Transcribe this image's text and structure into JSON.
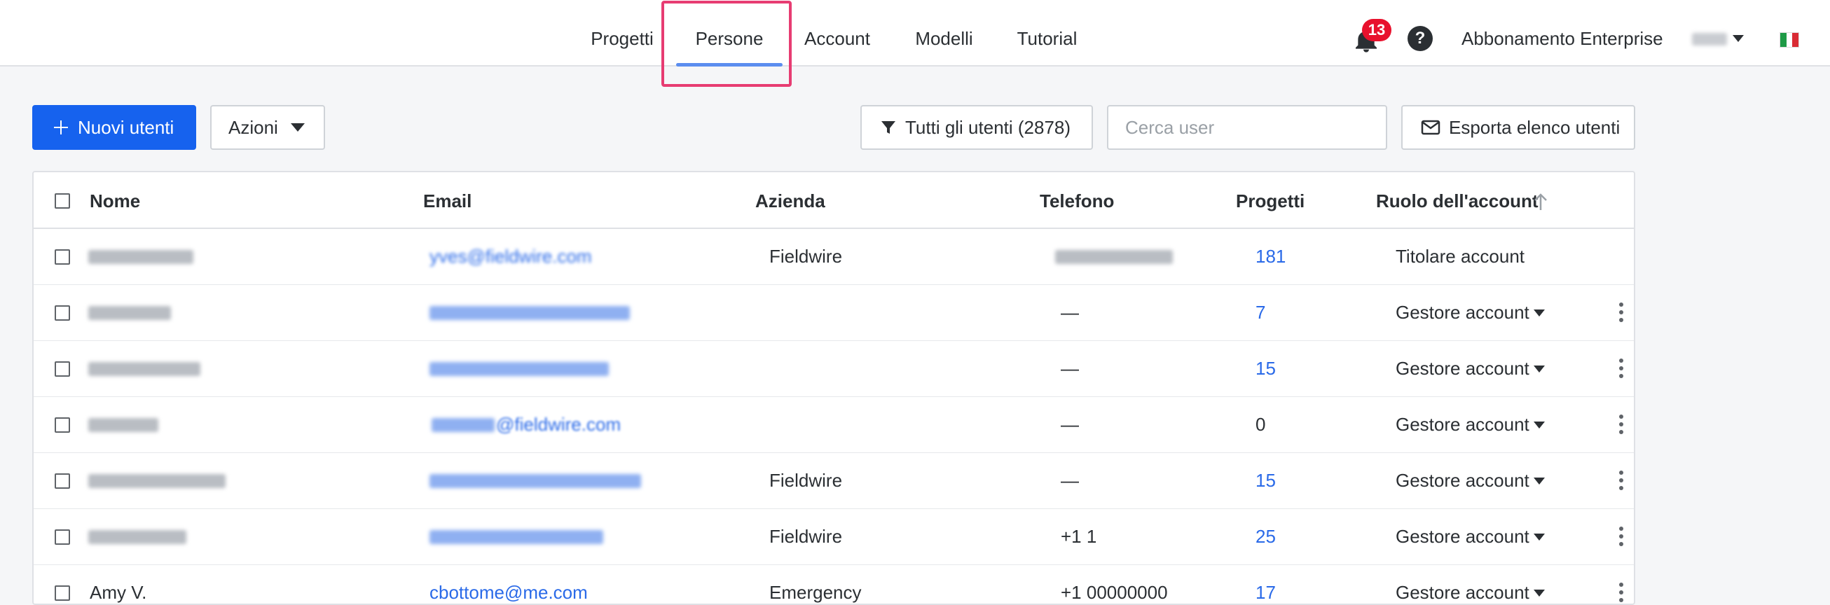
{
  "nav": {
    "tabs": [
      {
        "label": "Progetti"
      },
      {
        "label": "Persone"
      },
      {
        "label": "Account"
      },
      {
        "label": "Modelli"
      },
      {
        "label": "Tutorial"
      }
    ],
    "active_tab": "Persone",
    "notification_count": "13",
    "help_label": "?",
    "subscription": "Abbonamento Enterprise"
  },
  "toolbar": {
    "new_users_label": "Nuovi utenti",
    "actions_label": "Azioni",
    "filter_label": "Tutti gli utenti (2878)",
    "search_placeholder": "Cerca user",
    "export_label": "Esporta elenco utenti"
  },
  "table": {
    "columns": {
      "name": "Nome",
      "email": "Email",
      "company": "Azienda",
      "phone": "Telefono",
      "projects": "Progetti",
      "role": "Ruolo dell'account"
    },
    "rows": [
      {
        "name": "",
        "email": "yves@fieldwire.com",
        "company": "Fieldwire",
        "phone": "",
        "projects": "181",
        "role": "Titolare account"
      },
      {
        "name": "",
        "email": "",
        "company": "",
        "phone": "—",
        "projects": "7",
        "role": "Gestore account"
      },
      {
        "name": "",
        "email": "",
        "company": "",
        "phone": "—",
        "projects": "15",
        "role": "Gestore account"
      },
      {
        "name": "",
        "email": "@fieldwire.com",
        "company": "",
        "phone": "—",
        "projects": "0",
        "role": "Gestore account"
      },
      {
        "name": "",
        "email": "",
        "company": "Fieldwire",
        "phone": "—",
        "projects": "15",
        "role": "Gestore account"
      },
      {
        "name": "",
        "email": "",
        "company": "Fieldwire",
        "phone": "+1 1",
        "projects": "25",
        "role": "Gestore account"
      },
      {
        "name": "Amy V.",
        "email": "cbottome@me.com",
        "company": "Emergency",
        "phone": "+1 00000000",
        "projects": "17",
        "role": "Gestore account"
      }
    ]
  },
  "colors": {
    "primary": "#1662ee",
    "link": "#2a6ae8",
    "highlight": "#e73c72",
    "badge": "#e8112d",
    "tab_underline": "#5b8def"
  },
  "icons": [
    "plus-icon",
    "caret-down-icon",
    "filter-icon",
    "mail-icon",
    "bell-icon",
    "help-icon",
    "sort-up-icon",
    "kebab-icon",
    "italy-flag-icon"
  ]
}
